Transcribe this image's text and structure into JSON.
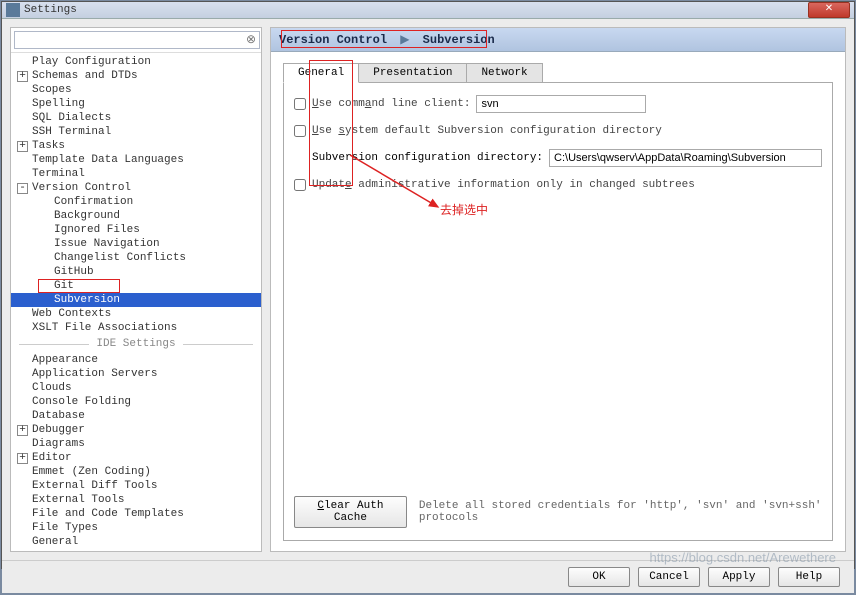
{
  "window": {
    "title": "Settings"
  },
  "search": {
    "placeholder": ""
  },
  "tree": {
    "items": [
      {
        "label": "Play Configuration",
        "indent": 0,
        "exp": ""
      },
      {
        "label": "Schemas and DTDs",
        "indent": 0,
        "exp": "+"
      },
      {
        "label": "Scopes",
        "indent": 0,
        "exp": ""
      },
      {
        "label": "Spelling",
        "indent": 0,
        "exp": ""
      },
      {
        "label": "SQL Dialects",
        "indent": 0,
        "exp": ""
      },
      {
        "label": "SSH Terminal",
        "indent": 0,
        "exp": ""
      },
      {
        "label": "Tasks",
        "indent": 0,
        "exp": "+"
      },
      {
        "label": "Template Data Languages",
        "indent": 0,
        "exp": ""
      },
      {
        "label": "Terminal",
        "indent": 0,
        "exp": ""
      },
      {
        "label": "Version Control",
        "indent": 0,
        "exp": "-"
      },
      {
        "label": "Confirmation",
        "indent": 1,
        "exp": ""
      },
      {
        "label": "Background",
        "indent": 1,
        "exp": ""
      },
      {
        "label": "Ignored Files",
        "indent": 1,
        "exp": ""
      },
      {
        "label": "Issue Navigation",
        "indent": 1,
        "exp": ""
      },
      {
        "label": "Changelist Conflicts",
        "indent": 1,
        "exp": ""
      },
      {
        "label": "GitHub",
        "indent": 1,
        "exp": ""
      },
      {
        "label": "Git",
        "indent": 1,
        "exp": ""
      },
      {
        "label": "Subversion",
        "indent": 1,
        "exp": "",
        "selected": true
      },
      {
        "label": "Web Contexts",
        "indent": 0,
        "exp": ""
      },
      {
        "label": "XSLT File Associations",
        "indent": 0,
        "exp": ""
      }
    ],
    "ide_label": "IDE Settings",
    "ide_items": [
      {
        "label": "Appearance",
        "indent": 0,
        "exp": ""
      },
      {
        "label": "Application Servers",
        "indent": 0,
        "exp": ""
      },
      {
        "label": "Clouds",
        "indent": 0,
        "exp": ""
      },
      {
        "label": "Console Folding",
        "indent": 0,
        "exp": ""
      },
      {
        "label": "Database",
        "indent": 0,
        "exp": ""
      },
      {
        "label": "Debugger",
        "indent": 0,
        "exp": "+"
      },
      {
        "label": "Diagrams",
        "indent": 0,
        "exp": ""
      },
      {
        "label": "Editor",
        "indent": 0,
        "exp": "+"
      },
      {
        "label": "Emmet (Zen Coding)",
        "indent": 0,
        "exp": ""
      },
      {
        "label": "External Diff Tools",
        "indent": 0,
        "exp": ""
      },
      {
        "label": "External Tools",
        "indent": 0,
        "exp": ""
      },
      {
        "label": "File and Code Templates",
        "indent": 0,
        "exp": ""
      },
      {
        "label": "File Types",
        "indent": 0,
        "exp": ""
      },
      {
        "label": "General",
        "indent": 0,
        "exp": ""
      }
    ]
  },
  "breadcrumb": {
    "a": "Version Control",
    "b": "Subversion"
  },
  "tabs": [
    "General",
    "Presentation",
    "Network"
  ],
  "form": {
    "use_cli": "Use command line client:",
    "cli_value": "svn",
    "use_default_dir": "Use system default Subversion configuration directory",
    "dir_label": "Subversion configuration directory:",
    "dir_value": "C:\\Users\\qwserv\\AppData\\Roaming\\Subversion",
    "update_admin": "Update administrative information only in changed subtrees",
    "clear_btn": "Clear Auth Cache",
    "clear_hint": "Delete all stored credentials for 'http', 'svn' and 'svn+ssh' protocols"
  },
  "buttons": {
    "ok": "OK",
    "cancel": "Cancel",
    "apply": "Apply",
    "help": "Help"
  },
  "annotation": {
    "text": "去掉选中"
  },
  "watermark": "https://blog.csdn.net/Arewethere"
}
